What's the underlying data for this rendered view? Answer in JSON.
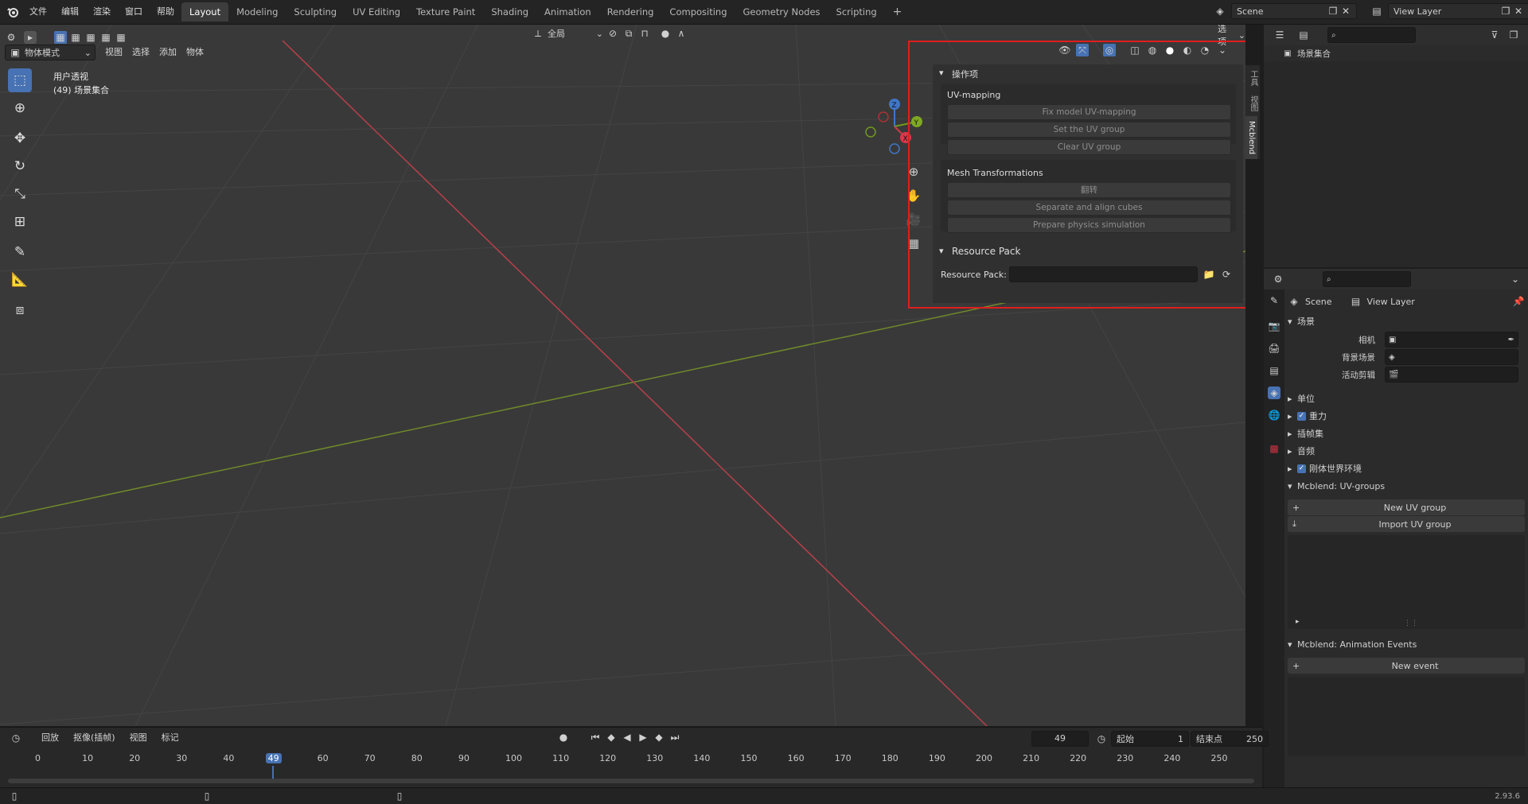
{
  "topbar": {
    "menus": [
      "文件",
      "编辑",
      "渲染",
      "窗口",
      "帮助"
    ],
    "workspaces": [
      "Layout",
      "Modeling",
      "Sculpting",
      "UV Editing",
      "Texture Paint",
      "Shading",
      "Animation",
      "Rendering",
      "Compositing",
      "Geometry Nodes",
      "Scripting"
    ],
    "active_workspace": "Layout",
    "add_tab": "+",
    "scene_name": "Scene",
    "view_layer_name": "View Layer"
  },
  "viewport_header": {
    "mode": "物体模式",
    "menus": [
      "视图",
      "选择",
      "添加",
      "物体"
    ],
    "transform_orientation": "全局",
    "options_label": "选项"
  },
  "viewport": {
    "view_name": "用户透视",
    "collection_info": "(49) 场景集合",
    "gizmo_axes": {
      "z": "Z",
      "y": "Y",
      "x": "X"
    }
  },
  "npanel": {
    "tabs": [
      "工具",
      "视图",
      "Mcblend"
    ],
    "operator_section": "操作项",
    "uv_mapping_title": "UV-mapping",
    "uv_buttons": [
      "Fix model UV-mapping",
      "Set the UV group",
      "Clear UV group"
    ],
    "mesh_title": "Mesh Transformations",
    "mesh_buttons": [
      "翻转",
      "Separate and align cubes",
      "Prepare physics simulation"
    ],
    "resource_section": "Resource Pack",
    "resource_label": "Resource Pack:",
    "resource_value": ""
  },
  "outliner": {
    "root_label": "场景集合"
  },
  "properties": {
    "breadcrumb_scene": "Scene",
    "breadcrumb_layer": "View Layer",
    "scene_panel_title": "场景",
    "camera_label": "相机",
    "background_label": "背景场景",
    "active_clip_label": "活动剪辑",
    "collapsed_panels": [
      {
        "label": "单位",
        "checkbox": false
      },
      {
        "label": "重力",
        "checkbox": true
      },
      {
        "label": "插帧集",
        "checkbox": false
      },
      {
        "label": "音频",
        "checkbox": false
      },
      {
        "label": "刚体世界环境",
        "checkbox": true
      }
    ],
    "uv_groups_title": "Mcblend: UV-groups",
    "new_uv_group": "New UV group",
    "import_uv_group": "Import UV group",
    "anim_events_title": "Mcblend: Animation Events",
    "new_event": "New event"
  },
  "timeline": {
    "menus": [
      "回放",
      "抠像(插帧)",
      "视图",
      "标记"
    ],
    "current_frame": "49",
    "start_label": "起始",
    "start_value": "1",
    "end_label": "结束点",
    "end_value": "250",
    "ticks": [
      "0",
      "10",
      "20",
      "30",
      "40",
      "49",
      "60",
      "70",
      "80",
      "90",
      "100",
      "110",
      "120",
      "130",
      "140",
      "150",
      "160",
      "170",
      "180",
      "190",
      "200",
      "210",
      "220",
      "230",
      "240",
      "250"
    ]
  },
  "statusbar": {
    "version": "2.93.6"
  },
  "colors": {
    "accent": "#4772b3",
    "x_axis": "#c2404e",
    "y_axis": "#7a9a2e",
    "highlight_box": "#e01e1e"
  }
}
